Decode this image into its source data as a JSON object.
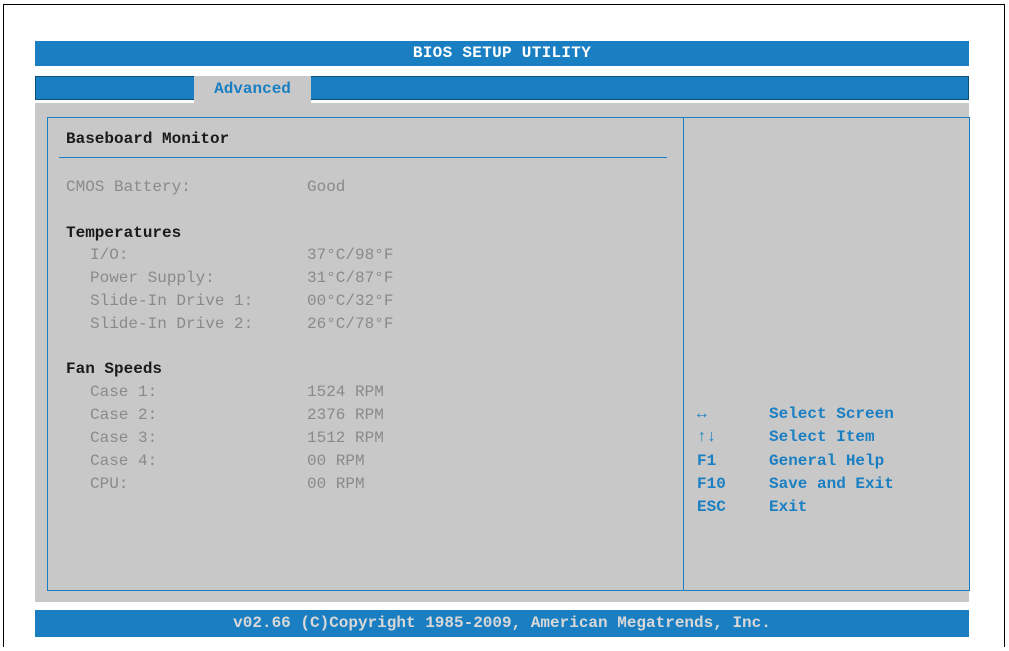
{
  "title": "BIOS SETUP UTILITY",
  "tabs": [
    {
      "label": "Advanced",
      "active": true
    }
  ],
  "main": {
    "section_title": "Baseboard Monitor",
    "cmos": {
      "label": "CMOS Battery:",
      "value": "Good"
    },
    "temperatures": {
      "heading": "Temperatures",
      "items": [
        {
          "label": "I/O:",
          "value": "37°C/98°F"
        },
        {
          "label": "Power Supply:",
          "value": "31°C/87°F"
        },
        {
          "label": "Slide-In Drive 1:",
          "value": "00°C/32°F"
        },
        {
          "label": "Slide-In Drive 2:",
          "value": "26°C/78°F"
        }
      ]
    },
    "fans": {
      "heading": "Fan Speeds",
      "items": [
        {
          "label": "Case 1:",
          "value": "1524 RPM"
        },
        {
          "label": "Case 2:",
          "value": "2376 RPM"
        },
        {
          "label": "Case 3:",
          "value": "1512 RPM"
        },
        {
          "label": "Case 4:",
          "value": "00 RPM"
        },
        {
          "label": "CPU:",
          "value": "00 RPM"
        }
      ]
    }
  },
  "help": [
    {
      "key": "↔",
      "desc": "Select Screen",
      "icon": "left-right-arrow-icon"
    },
    {
      "key": "↑↓",
      "desc": "Select Item",
      "icon": "up-down-arrow-icon"
    },
    {
      "key": "F1",
      "desc": "General Help"
    },
    {
      "key": "F10",
      "desc": "Save and Exit"
    },
    {
      "key": "ESC",
      "desc": "Exit"
    }
  ],
  "footer": "v02.66 (C)Copyright 1985-2009, American Megatrends, Inc.",
  "colors": {
    "accent": "#1a7fc2",
    "panel": "#c8c8c8",
    "dim_text": "#8a8a8a",
    "dark_text": "#1a1a1a"
  }
}
